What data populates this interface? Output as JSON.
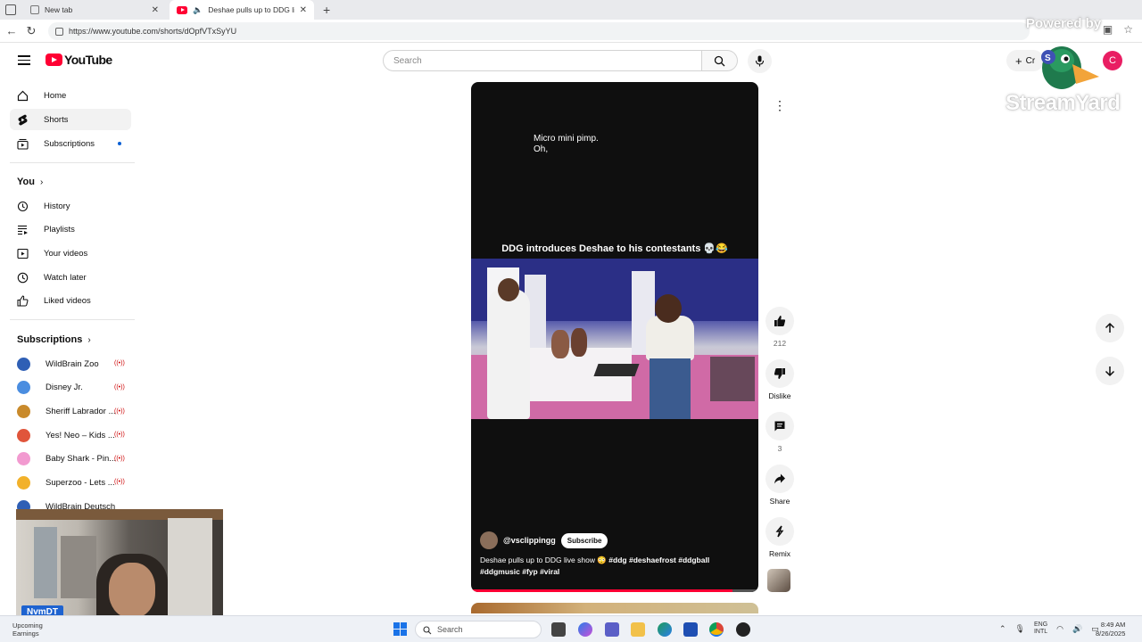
{
  "browser": {
    "tabs": [
      {
        "title": "New tab",
        "active": false
      },
      {
        "title": "Deshae pulls up to DDG live",
        "active": true
      }
    ],
    "url": "https://www.youtube.com/shorts/dOpfVTxSyYU"
  },
  "header": {
    "logo_text": "YouTube",
    "search_placeholder": "Search",
    "create_label": "Cr",
    "avatar_letter": "C"
  },
  "watermark": {
    "powered": "Powered by",
    "name": "StreamYard"
  },
  "sidebar": {
    "main": [
      {
        "label": "Home",
        "icon": "home-icon"
      },
      {
        "label": "Shorts",
        "icon": "shorts-icon",
        "active": true
      },
      {
        "label": "Subscriptions",
        "icon": "subscriptions-icon"
      }
    ],
    "you_heading": "You",
    "you": [
      {
        "label": "History",
        "icon": "history-icon"
      },
      {
        "label": "Playlists",
        "icon": "playlists-icon"
      },
      {
        "label": "Your videos",
        "icon": "your-videos-icon"
      },
      {
        "label": "Watch later",
        "icon": "watch-later-icon"
      },
      {
        "label": "Liked videos",
        "icon": "liked-videos-icon"
      }
    ],
    "subs_heading": "Subscriptions",
    "subscriptions": [
      {
        "label": "WildBrain Zoo",
        "color": "#2f5fb5"
      },
      {
        "label": "Disney Jr.",
        "color": "#4a8de0"
      },
      {
        "label": "Sheriff Labrador ...",
        "color": "#c98a2b"
      },
      {
        "label": "Yes! Neo – Kids ...",
        "color": "#e0553b"
      },
      {
        "label": "Baby Shark - Pin...",
        "color": "#f29ad0"
      },
      {
        "label": "Superzoo - Lets ...",
        "color": "#f2b12a"
      },
      {
        "label": "WildBrain Deutsch",
        "color": "#2f5fb5"
      }
    ]
  },
  "short": {
    "caption_line1": "Micro mini pimp.",
    "caption_line2": "Oh,",
    "overlay_title": "DDG introduces Deshae to his contestants 💀😂",
    "channel": "@vsclippingg",
    "subscribe_label": "Subscribe",
    "description_text": "Deshae pulls up to DDG live show 😳 ",
    "description_tags_1": "#ddg #deshaefrost #ddgball",
    "description_tags_2": "#ddgmusic #fyp #viral",
    "progress": 0.91
  },
  "actions": {
    "like_count": "212",
    "dislike_label": "Dislike",
    "comment_count": "3",
    "share_label": "Share",
    "remix_label": "Remix"
  },
  "webcam": {
    "name_tag": "NvmDT"
  },
  "taskbar": {
    "weather_line1": "Upcoming",
    "weather_line2": "Earnings",
    "search_placeholder": "Search",
    "lang_line1": "ENG",
    "lang_line2": "INTL",
    "time": "8:49 AM",
    "date": "8/26/2025"
  }
}
